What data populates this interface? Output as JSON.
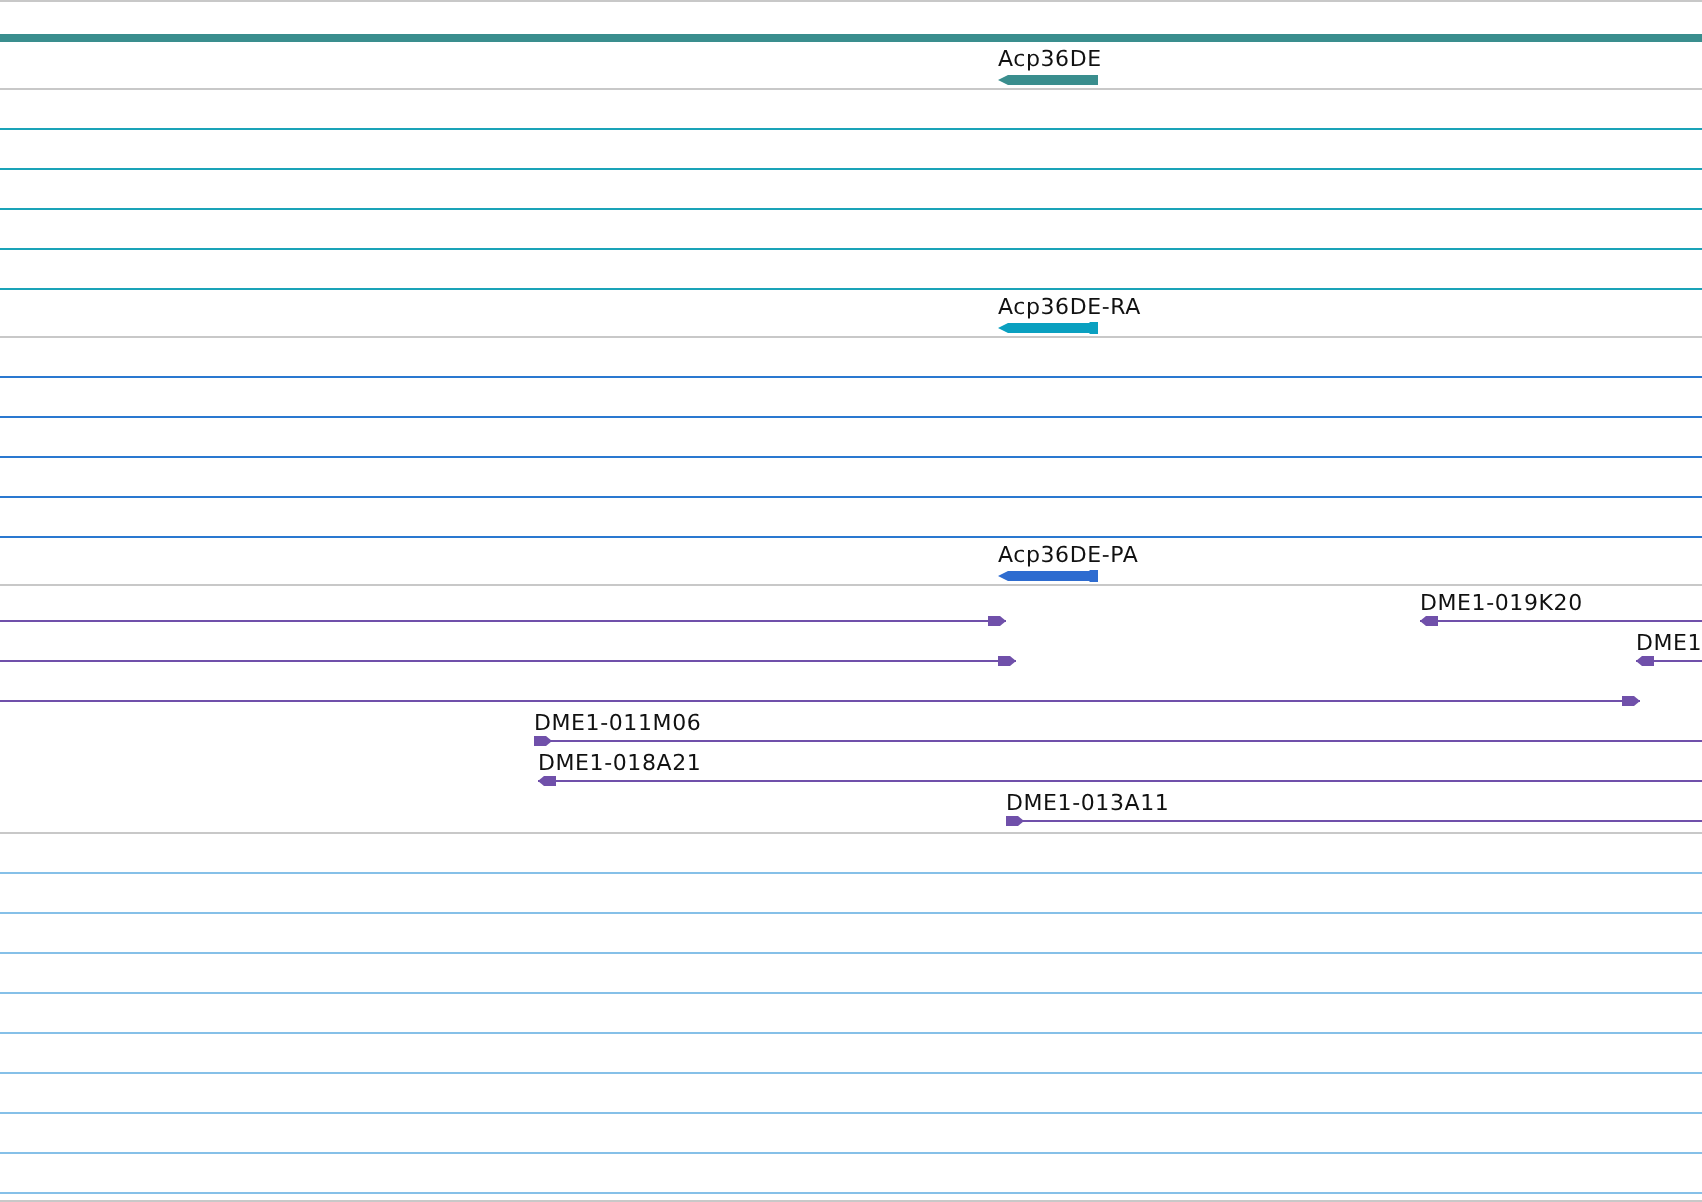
{
  "rows": [
    {
      "kind": "ruler",
      "color": "#3a8e8e"
    },
    {
      "kind": "gene",
      "color": "#3a8e8e",
      "features": [
        {
          "label": "Acp36DE",
          "reverse": true
        }
      ]
    },
    {
      "kind": "rule",
      "color": "#1aa3b8"
    },
    {
      "kind": "rule",
      "color": "#1aa3b8"
    },
    {
      "kind": "rule",
      "color": "#1aa3b8"
    },
    {
      "kind": "rule",
      "color": "#1aa3b8"
    },
    {
      "kind": "rule",
      "color": "#1aa3b8"
    },
    {
      "kind": "gene",
      "color": "#0aa0c0",
      "features": [
        {
          "label": "Acp36DE-RA",
          "reverse": true
        }
      ]
    },
    {
      "kind": "rule",
      "color": "#2a78d0"
    },
    {
      "kind": "rule",
      "color": "#2a78d0"
    },
    {
      "kind": "rule",
      "color": "#2a78d0"
    },
    {
      "kind": "rule",
      "color": "#2a78d0"
    },
    {
      "kind": "rule",
      "color": "#2a78d0"
    },
    {
      "kind": "gene",
      "color": "#2e6cd0",
      "features": [
        {
          "label": "Acp36DE-PA",
          "reverse": true
        }
      ]
    },
    {
      "kind": "clones",
      "color": "#7050aa",
      "lanes": [
        [
          {
            "reverse": false
          },
          {
            "label": "DME1-019K20",
            "reverse": true
          }
        ],
        [
          {
            "reverse": false
          },
          {
            "label": "DME1",
            "reverse": true
          }
        ],
        [
          {
            "reverse": false
          }
        ],
        [
          {
            "label": "DME1-011M06",
            "reverse": false
          }
        ],
        [
          {
            "label": "DME1-018A21",
            "reverse": true
          }
        ],
        [
          {
            "label": "DME1-013A11",
            "reverse": false
          }
        ]
      ]
    },
    {
      "kind": "rule",
      "color": "#86c0e8"
    },
    {
      "kind": "rule",
      "color": "#86c0e8"
    },
    {
      "kind": "rule",
      "color": "#86c0e8"
    },
    {
      "kind": "rule",
      "color": "#86c0e8"
    },
    {
      "kind": "rule",
      "color": "#86c0e8"
    },
    {
      "kind": "rule",
      "color": "#86c0e8"
    },
    {
      "kind": "rule",
      "color": "#86c0e8"
    },
    {
      "kind": "rule",
      "color": "#86c0e8"
    },
    {
      "kind": "rule",
      "color": "#86c0e8"
    },
    {
      "kind": "end",
      "color": "#c8c8c8"
    }
  ]
}
